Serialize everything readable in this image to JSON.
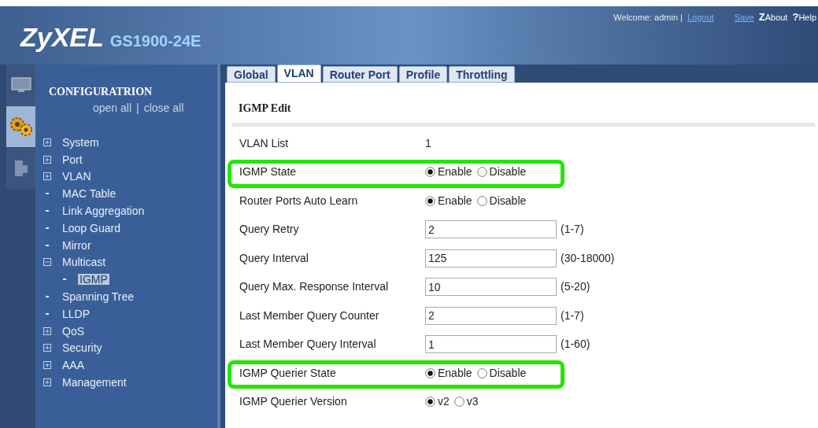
{
  "header": {
    "brand": "ZyXEL",
    "model": "GS1900-24E",
    "welcome": "Welcome: admin |",
    "links": [
      {
        "label": "Logout",
        "kind": "link"
      },
      {
        "label": "Save",
        "kind": "link"
      },
      {
        "icon": "Z",
        "label": "About",
        "kind": "icon"
      },
      {
        "icon": "?",
        "label": "Help",
        "kind": "icon"
      }
    ]
  },
  "rail": [
    {
      "kind": "monitor",
      "selected": false
    },
    {
      "kind": "gears",
      "selected": true
    },
    {
      "kind": "figure",
      "selected": false
    }
  ],
  "sidebar": {
    "title": "CONFIGURATRION",
    "open_all": "open all",
    "separator": "|",
    "close_all": "close all",
    "items": [
      {
        "label": "System",
        "kind": "folder",
        "expanded": false
      },
      {
        "label": "Port",
        "kind": "folder",
        "expanded": false
      },
      {
        "label": "VLAN",
        "kind": "folder",
        "expanded": false
      },
      {
        "label": "MAC Table",
        "kind": "leaf"
      },
      {
        "label": "Link Aggregation",
        "kind": "leaf"
      },
      {
        "label": "Loop Guard",
        "kind": "leaf"
      },
      {
        "label": "Mirror",
        "kind": "leaf"
      },
      {
        "label": "Multicast",
        "kind": "folder",
        "expanded": true,
        "children": [
          {
            "label": "IGMP",
            "kind": "leaf",
            "selected": true
          }
        ]
      },
      {
        "label": "Spanning Tree",
        "kind": "leaf"
      },
      {
        "label": "LLDP",
        "kind": "leaf"
      },
      {
        "label": "QoS",
        "kind": "folder",
        "expanded": false
      },
      {
        "label": "Security",
        "kind": "folder",
        "expanded": false
      },
      {
        "label": "AAA",
        "kind": "folder",
        "expanded": false
      },
      {
        "label": "Management",
        "kind": "folder",
        "expanded": false
      }
    ]
  },
  "tabs": [
    {
      "label": "Global",
      "selected": false
    },
    {
      "label": "VLAN",
      "selected": true
    },
    {
      "label": "Router Port",
      "selected": false
    },
    {
      "label": "Profile",
      "selected": false
    },
    {
      "label": "Throttling",
      "selected": false
    }
  ],
  "section_title": "IGMP Edit",
  "rows": [
    {
      "label": "VLAN List",
      "kind": "text",
      "value": "1",
      "highlighted": false
    },
    {
      "label": "IGMP State",
      "kind": "radio",
      "highlighted": true,
      "options": [
        {
          "label": "Enable",
          "selected": true
        },
        {
          "label": "Disable",
          "selected": false
        }
      ]
    },
    {
      "label": "Router Ports Auto Learn",
      "kind": "radio",
      "highlighted": false,
      "options": [
        {
          "label": "Enable",
          "selected": true
        },
        {
          "label": "Disable",
          "selected": false
        }
      ]
    },
    {
      "label": "Query Retry",
      "kind": "input",
      "value": "2",
      "range": "(1-7)",
      "highlighted": false
    },
    {
      "label": "Query Interval",
      "kind": "input",
      "value": "125",
      "range": "(30-18000)",
      "highlighted": false
    },
    {
      "label": "Query Max. Response Interval",
      "kind": "input",
      "value": "10",
      "range": "(5-20)",
      "highlighted": false
    },
    {
      "label": "Last Member Query Counter",
      "kind": "input",
      "value": "2",
      "range": "(1-7)",
      "highlighted": false
    },
    {
      "label": "Last Member Query Interval",
      "kind": "input",
      "value": "1",
      "range": "(1-60)",
      "highlighted": false
    },
    {
      "label": "IGMP Querier State",
      "kind": "radio",
      "highlighted": true,
      "options": [
        {
          "label": "Enable",
          "selected": true
        },
        {
          "label": "Disable",
          "selected": false
        }
      ]
    },
    {
      "label": "IGMP Querier Version",
      "kind": "radio",
      "highlighted": false,
      "options": [
        {
          "label": "v2",
          "selected": true
        },
        {
          "label": "v3",
          "selected": false
        }
      ]
    }
  ]
}
